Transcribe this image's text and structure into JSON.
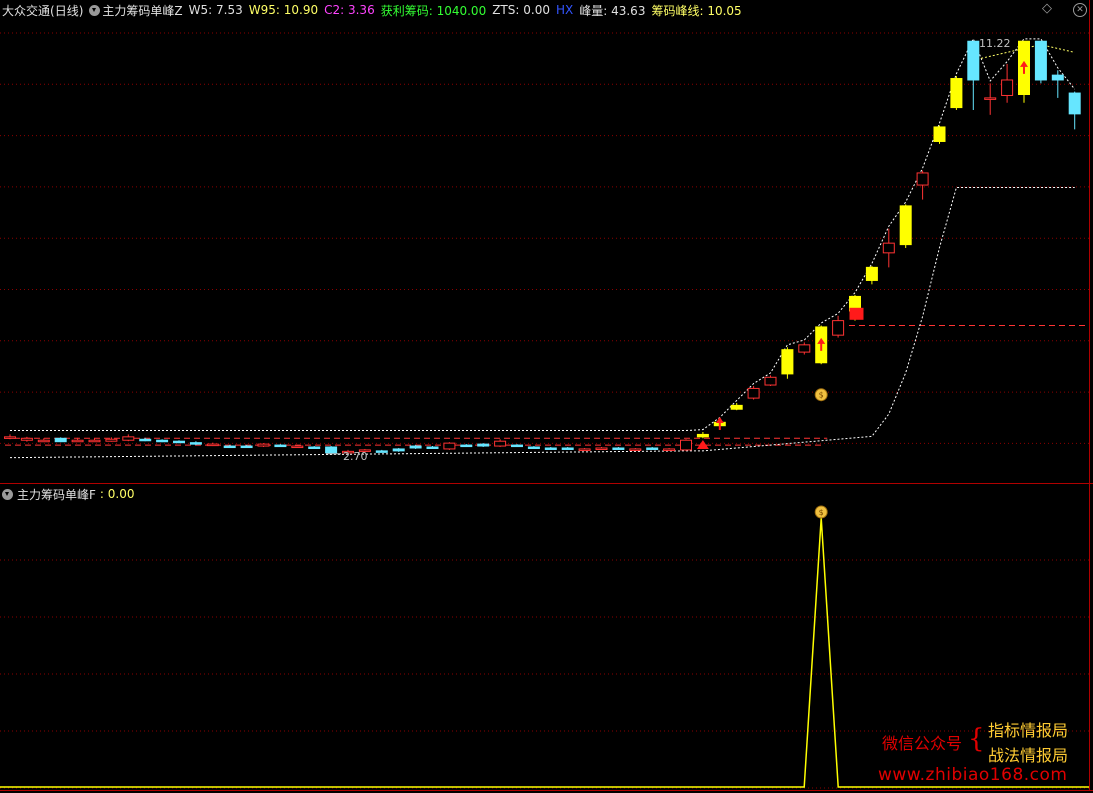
{
  "colors": {
    "background": "#000000",
    "grid": "#8b0000",
    "up_candle_yellow": "#ffff00",
    "up_candle_red": "#ff3333",
    "down_candle": "#66e6ff",
    "chip_line": "#ff3333",
    "band_line": "#ffffff",
    "indicator_line": "#ffff00"
  },
  "header": {
    "stock_name": "大众交通",
    "period": "(日线)",
    "indicator_name": "主力筹码单峰Z",
    "w5": {
      "label": "W5:",
      "value": "7.53",
      "color": "#e0e0e0"
    },
    "w95": {
      "label": "W95:",
      "value": "10.90",
      "color": "#ffff66"
    },
    "c2": {
      "label": "C2:",
      "value": "3.36",
      "color": "#ff44ff"
    },
    "profit": {
      "label": "获利筹码:",
      "value": "1040.00",
      "color": "#33ff33"
    },
    "zts": {
      "label": "ZTS:",
      "value": "0.00",
      "color": "#e0e0e0"
    },
    "hx": {
      "label": "HX",
      "color": "#3355ff"
    },
    "peak": {
      "label": "峰量:",
      "value": "43.63",
      "color": "#e0e0e0"
    },
    "peak_line": {
      "label": "筹码峰线:",
      "value": "10.05",
      "color": "#ffff66"
    }
  },
  "sub_header": {
    "indicator_name": "主力筹码单峰F",
    "value": ": 0.00"
  },
  "window_controls": {
    "diamond_icon": "diamond-icon",
    "close_icon": "close-icon"
  },
  "price_labels": {
    "high": "11.22",
    "low": "2.70"
  },
  "watermark": {
    "wechat": "微信公众号",
    "brace": "{",
    "line1": "指标情报局",
    "line2": "战法情报局",
    "url": "www.zhibiao168.com"
  },
  "chart_data": {
    "type": "candlestick",
    "ylim": [
      2.2,
      11.7
    ],
    "price_high_label": 11.22,
    "price_low_label": 2.7,
    "candles": [
      {
        "o": 3.05,
        "c": 3.05,
        "h": 3.1,
        "l": 3.0,
        "k": "r"
      },
      {
        "o": 3.02,
        "c": 2.98,
        "h": 3.05,
        "l": 2.95,
        "k": "r"
      },
      {
        "o": 2.98,
        "c": 2.98,
        "h": 3.02,
        "l": 2.95,
        "k": "r"
      },
      {
        "o": 3.02,
        "c": 2.95,
        "h": 3.04,
        "l": 2.94,
        "k": "d"
      },
      {
        "o": 2.98,
        "c": 2.98,
        "h": 3.03,
        "l": 2.95,
        "k": "r"
      },
      {
        "o": 2.98,
        "c": 2.98,
        "h": 3.02,
        "l": 2.95,
        "k": "r"
      },
      {
        "o": 3.0,
        "c": 2.96,
        "h": 3.04,
        "l": 2.95,
        "k": "r"
      },
      {
        "o": 2.98,
        "c": 3.05,
        "h": 3.1,
        "l": 2.96,
        "k": "r"
      },
      {
        "o": 3.0,
        "c": 2.98,
        "h": 3.03,
        "l": 2.96,
        "k": "d"
      },
      {
        "o": 2.98,
        "c": 2.96,
        "h": 3.0,
        "l": 2.94,
        "k": "d"
      },
      {
        "o": 2.96,
        "c": 2.93,
        "h": 2.98,
        "l": 2.92,
        "k": "d"
      },
      {
        "o": 2.93,
        "c": 2.9,
        "h": 2.96,
        "l": 2.88,
        "k": "d"
      },
      {
        "o": 2.9,
        "c": 2.88,
        "h": 2.93,
        "l": 2.86,
        "k": "r"
      },
      {
        "o": 2.86,
        "c": 2.86,
        "h": 2.88,
        "l": 2.84,
        "k": "d"
      },
      {
        "o": 2.86,
        "c": 2.86,
        "h": 2.88,
        "l": 2.84,
        "k": "d"
      },
      {
        "o": 2.86,
        "c": 2.9,
        "h": 2.92,
        "l": 2.84,
        "k": "r"
      },
      {
        "o": 2.88,
        "c": 2.86,
        "h": 2.9,
        "l": 2.84,
        "k": "d"
      },
      {
        "o": 2.86,
        "c": 2.86,
        "h": 2.88,
        "l": 2.84,
        "k": "r"
      },
      {
        "o": 2.84,
        "c": 2.84,
        "h": 2.86,
        "l": 2.82,
        "k": "d"
      },
      {
        "o": 2.84,
        "c": 2.72,
        "h": 2.86,
        "l": 2.7,
        "k": "d"
      },
      {
        "o": 2.75,
        "c": 2.75,
        "h": 2.78,
        "l": 2.72,
        "k": "r"
      },
      {
        "o": 2.78,
        "c": 2.76,
        "h": 2.8,
        "l": 2.74,
        "k": "r"
      },
      {
        "o": 2.76,
        "c": 2.76,
        "h": 2.78,
        "l": 2.74,
        "k": "d"
      },
      {
        "o": 2.76,
        "c": 2.8,
        "h": 2.82,
        "l": 2.74,
        "k": "d"
      },
      {
        "o": 2.82,
        "c": 2.86,
        "h": 2.88,
        "l": 2.8,
        "k": "d"
      },
      {
        "o": 2.84,
        "c": 2.84,
        "h": 2.86,
        "l": 2.82,
        "k": "d"
      },
      {
        "o": 2.8,
        "c": 2.92,
        "h": 2.94,
        "l": 2.78,
        "k": "r"
      },
      {
        "o": 2.88,
        "c": 2.88,
        "h": 2.9,
        "l": 2.86,
        "k": "d"
      },
      {
        "o": 2.86,
        "c": 2.9,
        "h": 2.92,
        "l": 2.84,
        "k": "d"
      },
      {
        "o": 2.86,
        "c": 2.96,
        "h": 3.0,
        "l": 2.84,
        "k": "r"
      },
      {
        "o": 2.88,
        "c": 2.88,
        "h": 2.9,
        "l": 2.86,
        "k": "d"
      },
      {
        "o": 2.84,
        "c": 2.84,
        "h": 2.86,
        "l": 2.82,
        "k": "d"
      },
      {
        "o": 2.82,
        "c": 2.82,
        "h": 2.84,
        "l": 2.8,
        "k": "d"
      },
      {
        "o": 2.82,
        "c": 2.82,
        "h": 2.84,
        "l": 2.8,
        "k": "d"
      },
      {
        "o": 2.8,
        "c": 2.8,
        "h": 2.82,
        "l": 2.78,
        "k": "r"
      },
      {
        "o": 2.82,
        "c": 2.82,
        "h": 2.84,
        "l": 2.8,
        "k": "r"
      },
      {
        "o": 2.82,
        "c": 2.82,
        "h": 2.84,
        "l": 2.8,
        "k": "d"
      },
      {
        "o": 2.8,
        "c": 2.8,
        "h": 2.82,
        "l": 2.78,
        "k": "r"
      },
      {
        "o": 2.82,
        "c": 2.82,
        "h": 2.84,
        "l": 2.8,
        "k": "d"
      },
      {
        "o": 2.8,
        "c": 2.8,
        "h": 2.82,
        "l": 2.78,
        "k": "r"
      },
      {
        "o": 2.78,
        "c": 2.98,
        "h": 3.0,
        "l": 2.76,
        "k": "r"
      },
      {
        "o": 3.05,
        "c": 3.1,
        "h": 3.15,
        "l": 3.02,
        "k": "y"
      },
      {
        "o": 3.28,
        "c": 3.35,
        "h": 3.4,
        "l": 3.25,
        "k": "y"
      },
      {
        "o": 3.62,
        "c": 3.7,
        "h": 3.75,
        "l": 3.6,
        "k": "y"
      },
      {
        "o": 3.85,
        "c": 4.05,
        "h": 4.1,
        "l": 3.82,
        "k": "r"
      },
      {
        "o": 4.12,
        "c": 4.28,
        "h": 4.32,
        "l": 4.1,
        "k": "r"
      },
      {
        "o": 4.35,
        "c": 4.85,
        "h": 4.9,
        "l": 4.25,
        "k": "y"
      },
      {
        "o": 4.8,
        "c": 4.95,
        "h": 5.0,
        "l": 4.75,
        "k": "r"
      },
      {
        "o": 4.58,
        "c": 5.32,
        "h": 5.35,
        "l": 4.55,
        "k": "y"
      },
      {
        "o": 5.15,
        "c": 5.45,
        "h": 5.55,
        "l": 5.1,
        "k": "r"
      },
      {
        "o": 5.65,
        "c": 5.95,
        "h": 5.98,
        "l": 5.45,
        "k": "y"
      },
      {
        "o": 6.28,
        "c": 6.55,
        "h": 6.58,
        "l": 6.2,
        "k": "y"
      },
      {
        "o": 6.85,
        "c": 7.05,
        "h": 7.35,
        "l": 6.55,
        "k": "r"
      },
      {
        "o": 7.02,
        "c": 7.82,
        "h": 7.85,
        "l": 6.95,
        "k": "y"
      },
      {
        "o": 8.25,
        "c": 8.5,
        "h": 8.55,
        "l": 7.95,
        "k": "r"
      },
      {
        "o": 9.15,
        "c": 9.45,
        "h": 9.48,
        "l": 9.1,
        "k": "y"
      },
      {
        "o": 9.85,
        "c": 10.45,
        "h": 10.5,
        "l": 9.8,
        "k": "y"
      },
      {
        "o": 10.42,
        "c": 11.22,
        "h": 11.22,
        "l": 9.8,
        "k": "d"
      },
      {
        "o": 10.02,
        "c": 10.05,
        "h": 10.35,
        "l": 9.7,
        "k": "r"
      },
      {
        "o": 10.1,
        "c": 10.42,
        "h": 10.75,
        "l": 9.95,
        "k": "r"
      },
      {
        "o": 10.12,
        "c": 11.22,
        "h": 11.22,
        "l": 9.95,
        "k": "y"
      },
      {
        "o": 11.22,
        "c": 10.42,
        "h": 11.22,
        "l": 10.35,
        "k": "d"
      },
      {
        "o": 10.52,
        "c": 10.42,
        "h": 10.62,
        "l": 10.05,
        "k": "d"
      },
      {
        "o": 10.15,
        "c": 9.72,
        "h": 10.18,
        "l": 9.4,
        "k": "d"
      }
    ],
    "chip_peak_levels": [
      {
        "from": 0,
        "to": 48,
        "value": 3.02
      },
      {
        "from": 50,
        "to": 63,
        "value": 5.35
      }
    ],
    "arrow_markers": [
      42,
      48,
      60
    ],
    "triangle_marker": 41,
    "moneybag_marker": 48,
    "solid_red_block": {
      "index": 50,
      "low": 5.4,
      "high": 5.55
    },
    "sub_indicator": {
      "name": "主力筹码单峰F",
      "pulse_index": 48,
      "pulse_value": 1,
      "base_value": 0
    }
  }
}
